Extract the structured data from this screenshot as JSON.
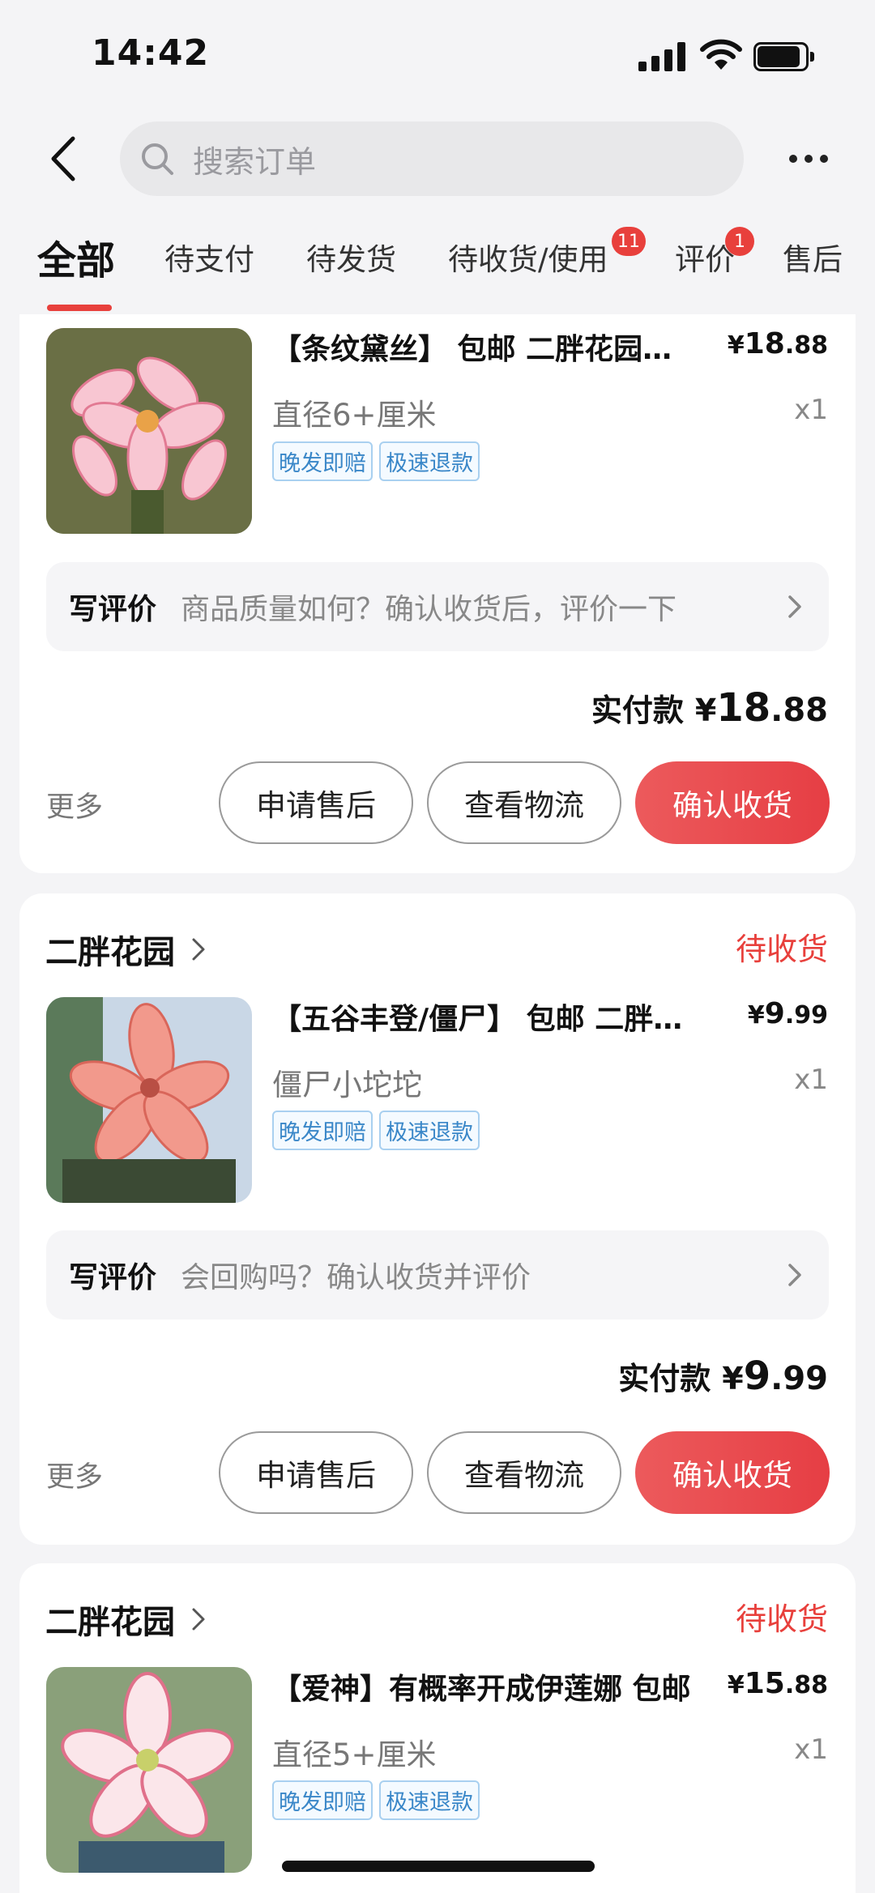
{
  "status_bar": {
    "time": "14:42"
  },
  "search": {
    "placeholder": "搜索订单"
  },
  "tabs": [
    {
      "label": "全部",
      "active": true
    },
    {
      "label": "待支付"
    },
    {
      "label": "待发货"
    },
    {
      "label": "待收货/使用",
      "badge": "11"
    },
    {
      "label": "评价",
      "badge": "1"
    },
    {
      "label": "售后"
    }
  ],
  "orders": [
    {
      "product": {
        "title": "【条纹黛丝】 包邮 二胖花园…",
        "price_yen": "¥",
        "price_int": "18",
        "price_dec": ".88",
        "spec": "直径6+厘米",
        "qty": "x1",
        "tags": [
          "晚发即赔",
          "极速退款"
        ]
      },
      "review": {
        "label": "写评价",
        "hint": "商品质量如何？确认收货后，评价一下"
      },
      "paid": {
        "label": "实付款",
        "yen": "¥",
        "int": "18",
        "dec": ".88"
      },
      "actions": {
        "more": "更多",
        "after_sale": "申请售后",
        "logistics": "查看物流",
        "confirm": "确认收货"
      }
    },
    {
      "shop": "二胖花园",
      "status": "待收货",
      "product": {
        "title": "【五谷丰登/僵尸】 包邮 二胖花园",
        "price_yen": "¥",
        "price_int": "9",
        "price_dec": ".99",
        "spec": "僵尸小坨坨",
        "qty": "x1",
        "tags": [
          "晚发即赔",
          "极速退款"
        ]
      },
      "review": {
        "label": "写评价",
        "hint": "会回购吗？确认收货并评价"
      },
      "paid": {
        "label": "实付款",
        "yen": "¥",
        "int": "9",
        "dec": ".99"
      },
      "actions": {
        "more": "更多",
        "after_sale": "申请售后",
        "logistics": "查看物流",
        "confirm": "确认收货"
      }
    },
    {
      "shop": "二胖花园",
      "status": "待收货",
      "product": {
        "title": "【爱神】有概率开成伊莲娜 包邮",
        "price_yen": "¥",
        "price_int": "15",
        "price_dec": ".88",
        "spec": "直径5+厘米",
        "qty": "x1",
        "tags": [
          "晚发即赔",
          "极速退款"
        ]
      }
    }
  ],
  "colors": {
    "accent": "#e8403c",
    "tag_blue": "#3a87c8"
  }
}
